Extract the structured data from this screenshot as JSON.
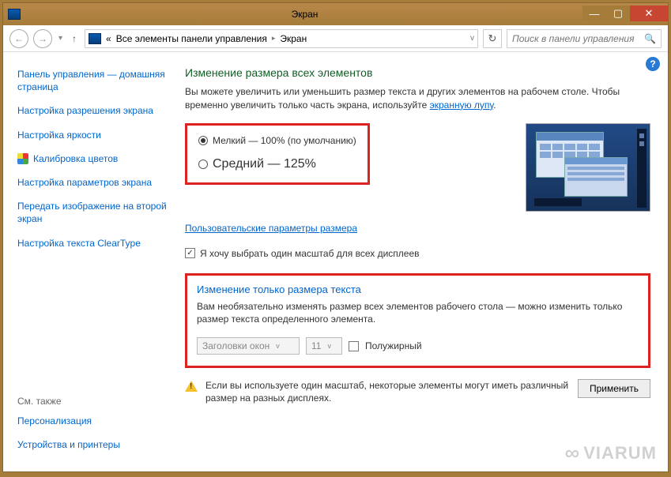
{
  "window": {
    "title": "Экран"
  },
  "nav": {
    "breadcrumb_prefix": "«",
    "breadcrumb1": "Все элементы панели управления",
    "breadcrumb2": "Экран",
    "search_placeholder": "Поиск в панели управления"
  },
  "sidebar": {
    "items": [
      "Панель управления — домашняя страница",
      "Настройка разрешения экрана",
      "Настройка яркости",
      "Калибровка цветов",
      "Настройка параметров экрана",
      "Передать изображение на второй экран",
      "Настройка текста ClearType"
    ],
    "see_also": "См. также",
    "bottom": [
      "Персонализация",
      "Устройства и принтеры"
    ]
  },
  "main": {
    "h1": "Изменение размера всех элементов",
    "desc_a": "Вы можете увеличить или уменьшить размер текста и других элементов на рабочем столе. Чтобы временно увеличить только часть экрана, используйте ",
    "desc_link": "экранную лупу",
    "radio_small": "Мелкий — 100% (по умолчанию)",
    "radio_medium": "Средний — 125%",
    "custom_link": "Пользовательские параметры размера",
    "chk_label": "Я хочу выбрать один масштаб для всех дисплеев",
    "h2": "Изменение только размера текста",
    "desc2": "Вам необязательно изменять размер всех элементов рабочего стола — можно изменить только размер текста определенного элемента.",
    "combo_element": "Заголовки окон",
    "combo_size": "11",
    "bold_label": "Полужирный",
    "warn_text": "Если вы используете один масштаб, некоторые элементы могут иметь различный размер на разных дисплеях.",
    "apply": "Применить"
  },
  "watermark": "VIARUM"
}
